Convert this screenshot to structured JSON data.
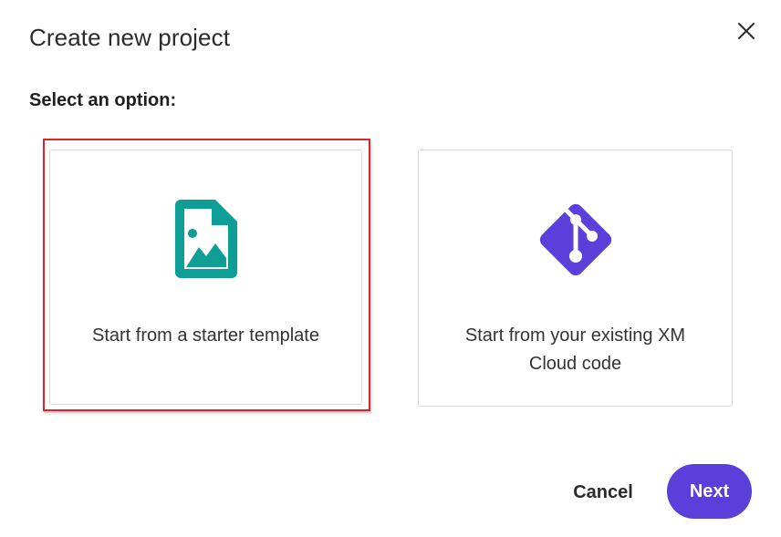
{
  "dialog": {
    "title": "Create new project",
    "subtitle": "Select an option:"
  },
  "options": [
    {
      "label": "Start from a starter template",
      "icon": "image-file-icon",
      "color": "#0e9e96",
      "selected": true
    },
    {
      "label": "Start from your existing XM Cloud code",
      "icon": "git-icon",
      "color": "#5a3fdb",
      "selected": false
    }
  ],
  "footer": {
    "cancel_label": "Cancel",
    "next_label": "Next"
  },
  "colors": {
    "accent": "#5a3fdb",
    "highlight": "#d9262c",
    "template_icon": "#0e9e96"
  }
}
